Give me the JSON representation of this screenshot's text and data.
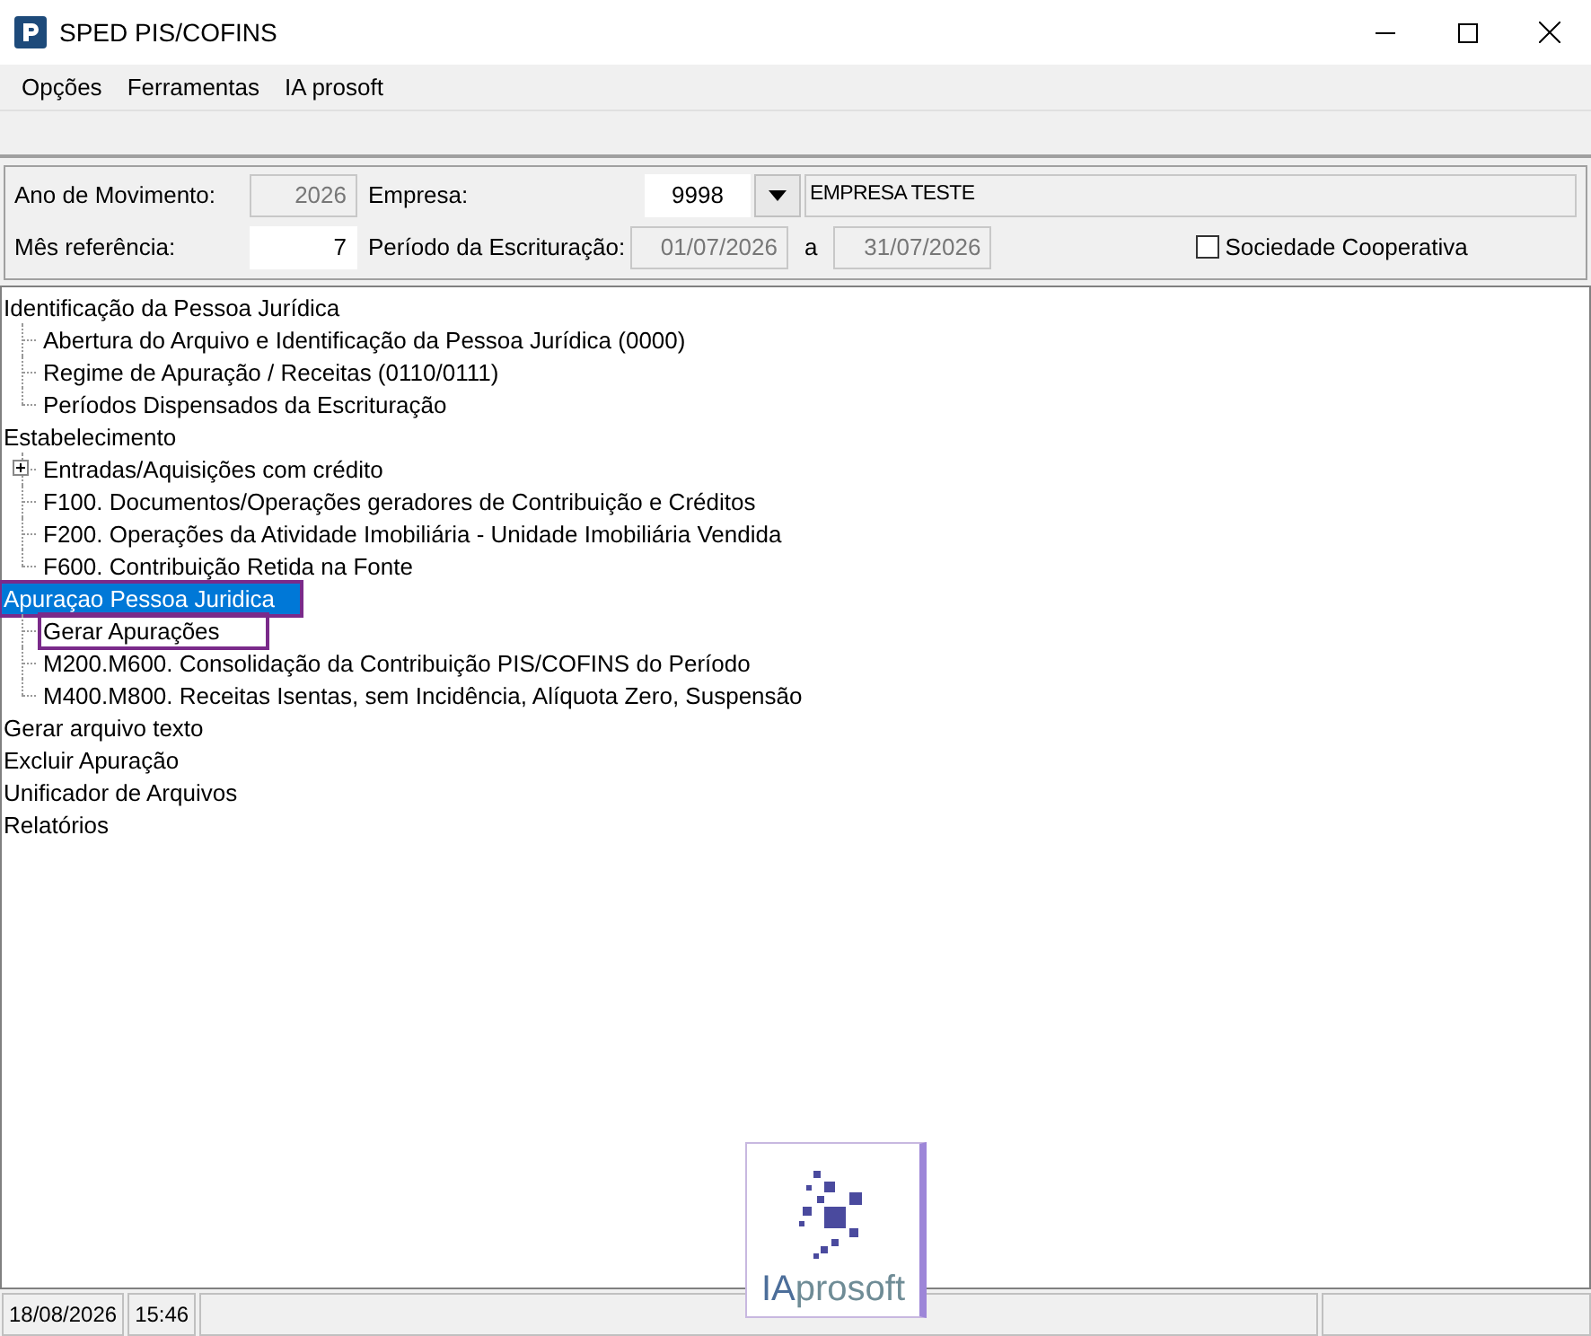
{
  "window": {
    "title": "SPED PIS/COFINS"
  },
  "menu": [
    "Opções",
    "Ferramentas",
    "IA prosoft"
  ],
  "form": {
    "ano": {
      "label": "Ano de Movimento:",
      "value": "2026",
      "disabled": true
    },
    "empresa": {
      "label": "Empresa:",
      "code": "9998",
      "name": "EMPRESA TESTE"
    },
    "mes": {
      "label": "Mês referência:",
      "value": "7",
      "disabled": false
    },
    "periodo": {
      "label": "Período da Escrituração:",
      "start": "01/07/2026",
      "separator": "a",
      "end": "31/07/2026",
      "disabled": true
    },
    "cooperativa": {
      "label": "Sociedade Cooperativa",
      "checked": false
    }
  },
  "tree": [
    {
      "label": "Identificação da Pessoa Jurídica",
      "selected": false,
      "outlined": false,
      "children": [
        {
          "label": "Abertura do Arquivo e Identificação da Pessoa Jurídica (0000)",
          "selected": false,
          "outlined": false
        },
        {
          "label": "Regime de Apuração / Receitas (0110/0111)",
          "selected": false,
          "outlined": false
        },
        {
          "label": "Períodos Dispensados da Escrituração",
          "selected": false,
          "outlined": false
        }
      ]
    },
    {
      "label": "Estabelecimento",
      "selected": false,
      "outlined": false,
      "children": [
        {
          "label": "Entradas/Aquisições com crédito",
          "selected": false,
          "outlined": false,
          "expanded": false
        },
        {
          "label": "F100. Documentos/Operações geradores de Contribuição e Créditos",
          "selected": false,
          "outlined": false
        },
        {
          "label": "F200. Operações da Atividade Imobiliária - Unidade Imobiliária Vendida",
          "selected": false,
          "outlined": false
        },
        {
          "label": "F600. Contribuição Retida na Fonte",
          "selected": false,
          "outlined": false
        }
      ]
    },
    {
      "label": "Apuraçao Pessoa Juridica",
      "selected": true,
      "outlined": true,
      "children": [
        {
          "label": "Gerar Apurações",
          "selected": false,
          "outlined": true
        },
        {
          "label": "M200.M600. Consolidação da Contribuição PIS/COFINS do Período",
          "selected": false,
          "outlined": false
        },
        {
          "label": "M400.M800. Receitas Isentas, sem Incidência, Alíquota Zero, Suspensão",
          "selected": false,
          "outlined": false
        }
      ]
    },
    {
      "label": "Gerar arquivo texto",
      "selected": false,
      "outlined": false
    },
    {
      "label": "Excluir Apuração",
      "selected": false,
      "outlined": false
    },
    {
      "label": "Unificador de Arquivos",
      "selected": false,
      "outlined": false
    },
    {
      "label": "Relatórios",
      "selected": false,
      "outlined": false
    }
  ],
  "status_bar": [
    "18/08/2026",
    "15:46"
  ],
  "logo": {
    "prefix": "IA",
    "suffix": "prosoft"
  }
}
